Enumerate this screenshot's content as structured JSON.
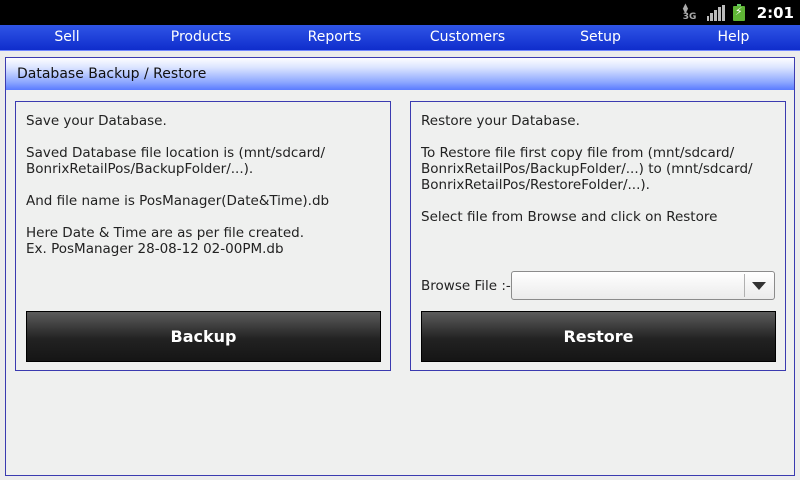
{
  "status_bar": {
    "time": "2:01",
    "network_label": "3G",
    "icons": [
      "network-3g-icon",
      "signal-icon",
      "battery-charging-icon"
    ]
  },
  "menu": [
    "Sell",
    "Products",
    "Reports",
    "Customers",
    "Setup",
    "Help"
  ],
  "page": {
    "title": "Database Backup / Restore"
  },
  "backup": {
    "lines": [
      "Save your Database.",
      "Saved Database file location is (mnt/sdcard/",
      "BonrixRetailPos/BackupFolder/...).",
      "And file name is PosManager(Date&Time).db",
      "Here Date & Time are as per file created.",
      "Ex. PosManager 28-08-12 02-00PM.db"
    ],
    "button_label": "Backup"
  },
  "restore": {
    "lines": [
      "Restore your Database.",
      "To Restore file first copy file from (mnt/sdcard/",
      "BonrixRetailPos/BackupFolder/...) to (mnt/sdcard/",
      "BonrixRetailPos/RestoreFolder/...).",
      "Select file from Browse and click on Restore"
    ],
    "browse_label": "Browse File :-",
    "browse_value": "",
    "button_label": "Restore"
  },
  "colors": {
    "menu_bar": "#1a3ad8",
    "panel_border": "#3b3bb0",
    "button_dark": "#222222",
    "battery": "#5fb535"
  }
}
